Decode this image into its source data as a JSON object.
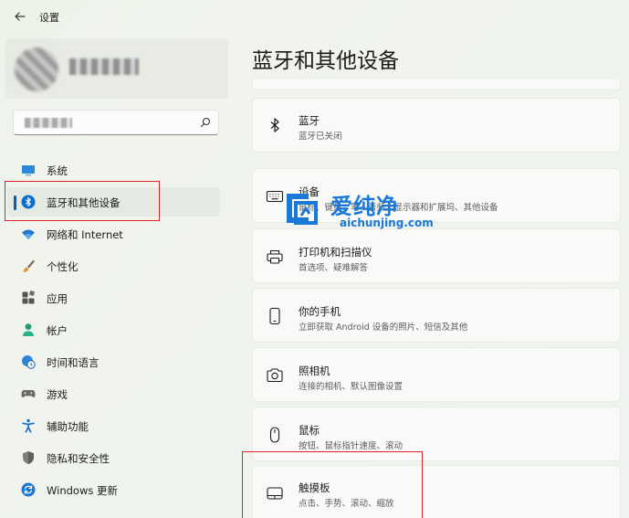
{
  "window": {
    "title": "设置"
  },
  "sidebar": {
    "items": [
      {
        "id": "system",
        "label": "系统",
        "icon": "monitor-icon"
      },
      {
        "id": "bluetooth",
        "label": "蓝牙和其他设备",
        "icon": "bluetooth-icon",
        "active": true
      },
      {
        "id": "network",
        "label": "网络和 Internet",
        "icon": "wifi-icon"
      },
      {
        "id": "personalization",
        "label": "个性化",
        "icon": "brush-icon"
      },
      {
        "id": "apps",
        "label": "应用",
        "icon": "apps-icon"
      },
      {
        "id": "accounts",
        "label": "帐户",
        "icon": "person-icon"
      },
      {
        "id": "time",
        "label": "时间和语言",
        "icon": "globe-clock-icon"
      },
      {
        "id": "gaming",
        "label": "游戏",
        "icon": "gamepad-icon"
      },
      {
        "id": "accessibility",
        "label": "辅助功能",
        "icon": "accessibility-icon"
      },
      {
        "id": "privacy",
        "label": "隐私和安全性",
        "icon": "shield-icon"
      },
      {
        "id": "update",
        "label": "Windows 更新",
        "icon": "update-icon"
      }
    ]
  },
  "main": {
    "title": "蓝牙和其他设备",
    "cards": [
      {
        "title": "蓝牙",
        "subtitle": "蓝牙已关闭",
        "icon": "bluetooth-icon"
      },
      {
        "title": "设备",
        "subtitle": "鼠标、键盘、笔、音频、显示器和扩展坞、其他设备",
        "icon": "keyboard-icon"
      },
      {
        "title": "打印机和扫描仪",
        "subtitle": "首选项、疑难解答",
        "icon": "printer-icon"
      },
      {
        "title": "你的手机",
        "subtitle": "立即获取 Android 设备的照片、短信及其他",
        "icon": "phone-icon"
      },
      {
        "title": "照相机",
        "subtitle": "连接的相机、默认图像设置",
        "icon": "camera-icon"
      },
      {
        "title": "鼠标",
        "subtitle": "按钮、鼠标指针速度、滚动",
        "icon": "mouse-icon"
      },
      {
        "title": "触摸板",
        "subtitle": "点击、手势、滚动、缩放",
        "icon": "touchpad-icon"
      }
    ]
  },
  "watermark": {
    "title": "爱纯净",
    "url": "aichunjing.com"
  },
  "colors": {
    "accent": "#005fb8",
    "highlight": "#e0202a",
    "watermark": "#1a78d6"
  }
}
